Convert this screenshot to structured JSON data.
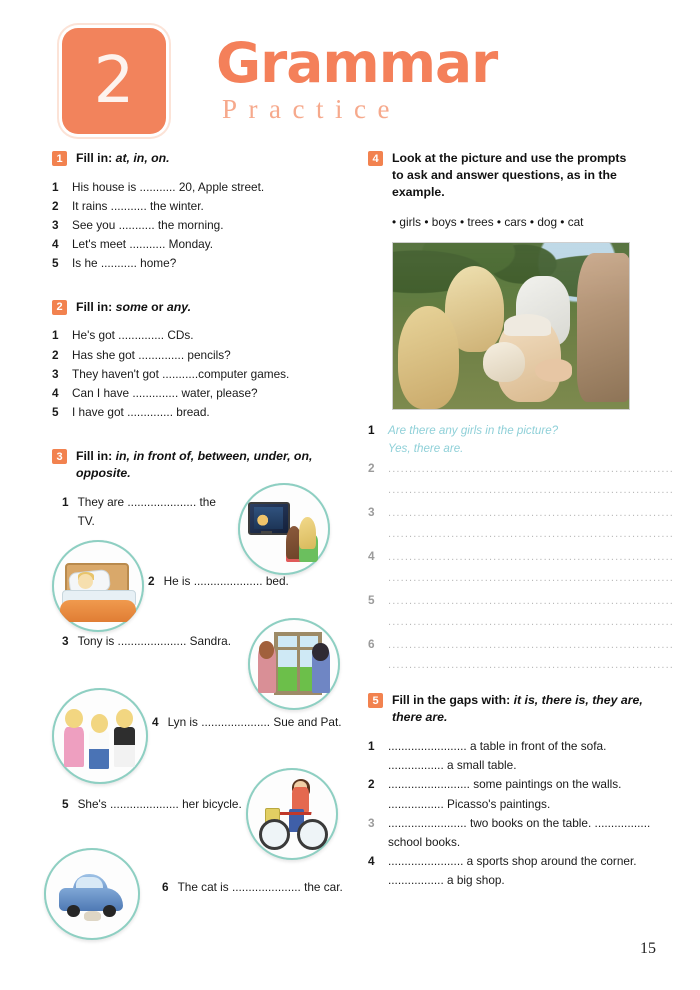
{
  "header": {
    "unit_number": "2",
    "title": "Grammar",
    "subtitle": "Practice",
    "brand_color": "#f2835c",
    "subtitle_color": "#f6a98c"
  },
  "page_number": "15",
  "exercises": [
    {
      "number": "1",
      "instruction_plain": "Fill in: ",
      "instruction_italic": "at, in, on.",
      "items": [
        {
          "n": "1",
          "text": "His house is ........... 20, Apple street."
        },
        {
          "n": "2",
          "text": "It rains ........... the winter."
        },
        {
          "n": "3",
          "text": "See you ........... the morning."
        },
        {
          "n": "4",
          "text": "Let's meet ........... Monday."
        },
        {
          "n": "5",
          "text": "Is he ........... home?"
        }
      ]
    },
    {
      "number": "2",
      "instruction_plain": "Fill in: ",
      "instruction_italic": "some",
      "instruction_plain2": " or ",
      "instruction_italic2": "any.",
      "items": [
        {
          "n": "1",
          "text": "He's got .............. CDs."
        },
        {
          "n": "2",
          "text": "Has she got .............. pencils?"
        },
        {
          "n": "3",
          "text": "They haven't got ...........computer games."
        },
        {
          "n": "4",
          "text": "Can I have .............. water, please?"
        },
        {
          "n": "5",
          "text": "I have got .............. bread."
        }
      ]
    },
    {
      "number": "3",
      "instruction_plain": "Fill in: ",
      "instruction_italic": "in, in front of, between, under, on, opposite.",
      "items": [
        {
          "n": "1",
          "text": "They are ..................... the TV."
        },
        {
          "n": "2",
          "text": "He is ..................... bed."
        },
        {
          "n": "3",
          "text": "Tony is ..................... Sandra."
        },
        {
          "n": "4",
          "text": "Lyn is ..................... Sue and Pat."
        },
        {
          "n": "5",
          "text": "She's ..................... her bicycle."
        },
        {
          "n": "6",
          "text": "The cat is ..................... the car."
        }
      ],
      "illustrations": [
        {
          "name": "tv-scene",
          "caption": "two children watching a television"
        },
        {
          "name": "bed-scene",
          "caption": "a boy lying in bed under an orange blanket"
        },
        {
          "name": "window-scene",
          "caption": "two people talking at an open window"
        },
        {
          "name": "three-girls-scene",
          "caption": "three girls standing side by side"
        },
        {
          "name": "bicycle-scene",
          "caption": "a girl riding a bicycle"
        },
        {
          "name": "car-scene",
          "caption": "a cat under a blue car"
        }
      ]
    },
    {
      "number": "4",
      "instruction_line1": "Look at the picture and use the prompts",
      "instruction_line2": "to ask and answer questions, as in the",
      "instruction_line3": "example.",
      "prompts": [
        "girls",
        "boys",
        "trees",
        "cars",
        "dog",
        "cat"
      ],
      "photo_caption": "children outdoors gathered around a small animal",
      "example": {
        "n": "1",
        "question": "Are there any girls in the picture?",
        "answer": "Yes, there are.",
        "color": "#8fd0d8"
      },
      "blank_rows": [
        "2",
        "3",
        "4",
        "5",
        "6"
      ],
      "blank_line": "...................................................................."
    },
    {
      "number": "5",
      "instruction_plain": "Fill in the gaps with: ",
      "instruction_italic": "it is, there is, they are, there are.",
      "items": [
        {
          "n": "1",
          "text": "........................ a table in front of the sofa. ................. a small table."
        },
        {
          "n": "2",
          "text": "......................... some paintings on the walls. ................. Picasso's paintings."
        },
        {
          "n": "3",
          "text": "........................ two books on the table. ................. school books."
        },
        {
          "n": "4",
          "text": "....................... a sports shop around the corner. ................. a big shop."
        }
      ]
    }
  ]
}
